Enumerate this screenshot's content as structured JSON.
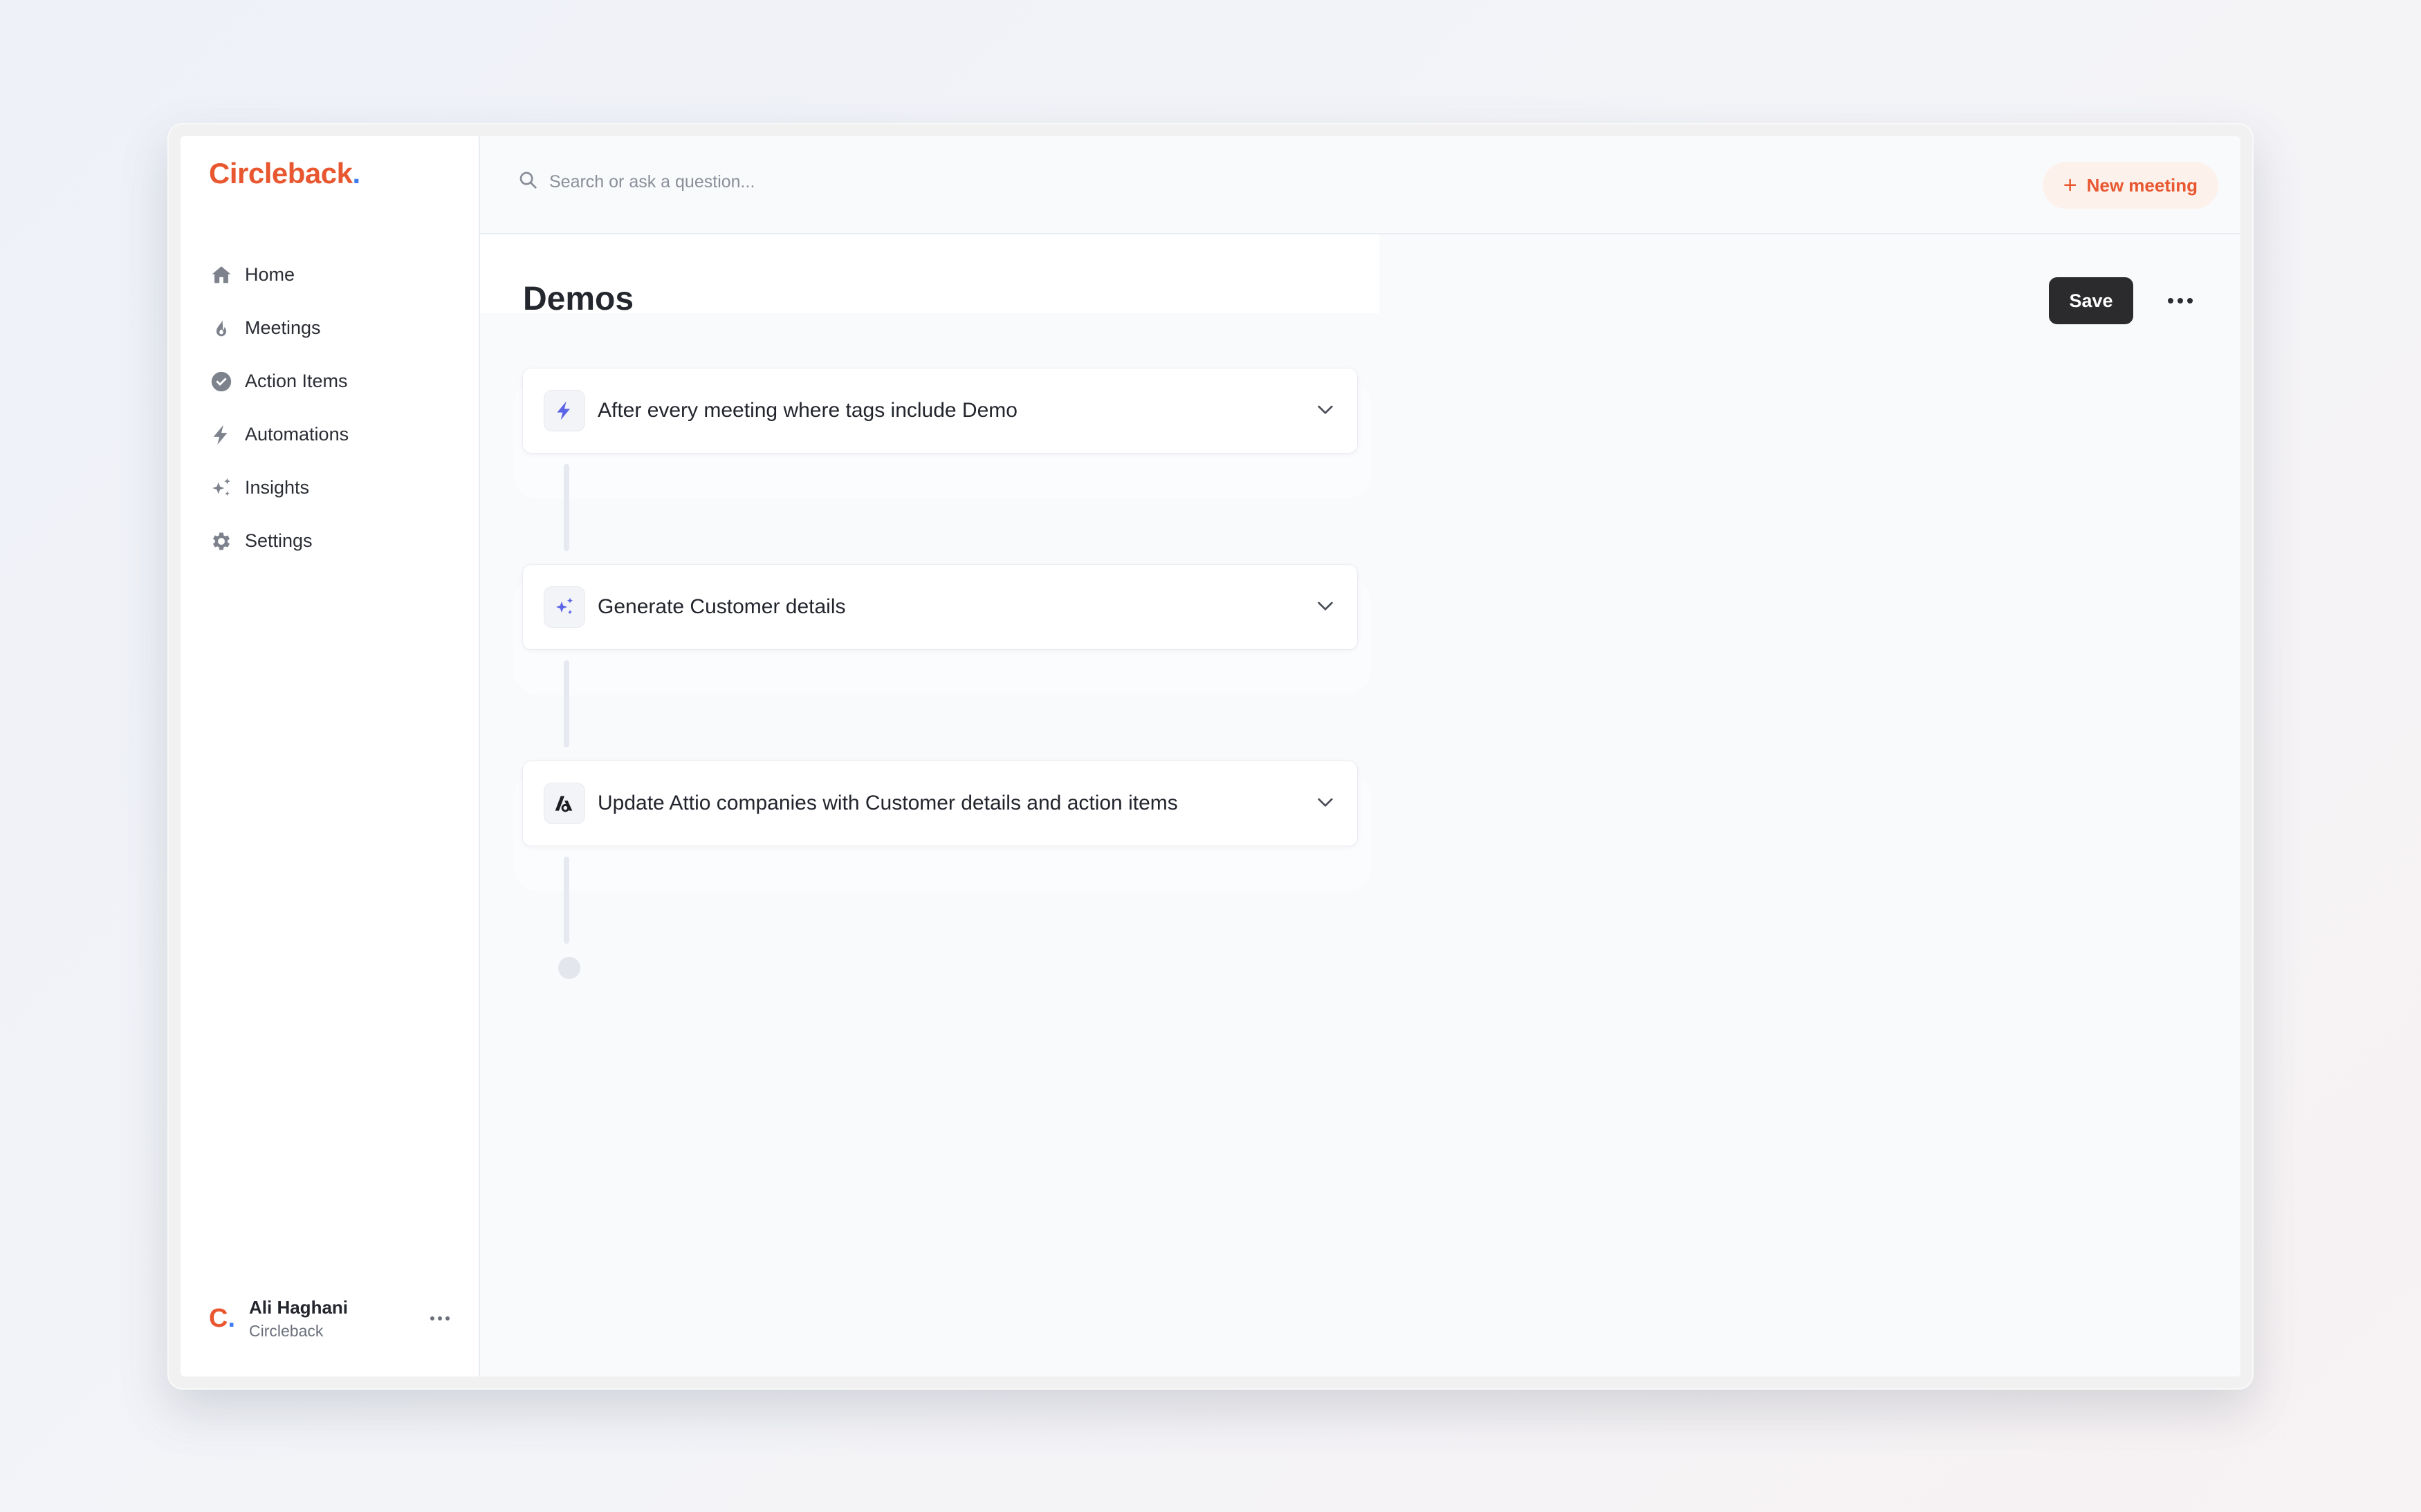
{
  "brand": {
    "name": "Circleback",
    "dot": ".",
    "brand_color": "#e8572f",
    "dot_color": "#3e7bf0"
  },
  "sidebar": {
    "items": [
      {
        "label": "Home",
        "icon": "home-icon"
      },
      {
        "label": "Meetings",
        "icon": "flame-icon"
      },
      {
        "label": "Action Items",
        "icon": "check-circle-icon"
      },
      {
        "label": "Automations",
        "icon": "bolt-icon"
      },
      {
        "label": "Insights",
        "icon": "sparkles-icon"
      },
      {
        "label": "Settings",
        "icon": "gear-icon"
      }
    ],
    "user": {
      "logo": "C",
      "logo_dot": ".",
      "name": "Ali Haghani",
      "org": "Circleback"
    }
  },
  "topbar": {
    "search_placeholder": "Search or ask a question...",
    "new_meeting_label": "New meeting"
  },
  "page": {
    "title": "Demos",
    "save_label": "Save"
  },
  "workflow": {
    "steps": [
      {
        "label": "After every meeting where tags include Demo",
        "icon": "bolt-icon"
      },
      {
        "label": "Generate Customer details",
        "icon": "sparkles-icon"
      },
      {
        "label": "Update Attio companies with Customer details and action items",
        "icon": "attio-icon"
      }
    ]
  }
}
